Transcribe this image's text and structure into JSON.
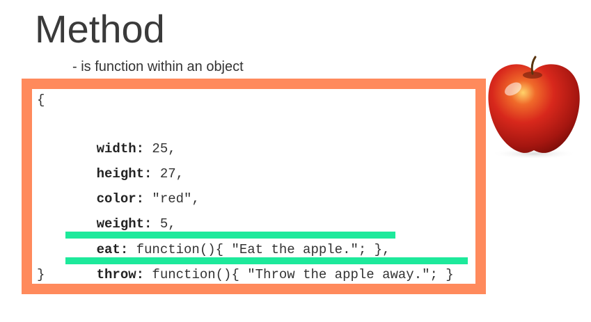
{
  "slide": {
    "title": "Method",
    "subtitle": "- is function within an object"
  },
  "code": {
    "open_brace": "{",
    "close_brace": "}",
    "lines": [
      {
        "key": "width:",
        "rest": " 25,"
      },
      {
        "key": "height:",
        "rest": " 27,"
      },
      {
        "key": "color:",
        "rest": " \"red\","
      },
      {
        "key": "weight:",
        "rest": " 5,"
      },
      {
        "key": "eat:",
        "rest": " function(){ \"Eat the apple.\"; },"
      },
      {
        "key": "throw:",
        "rest": " function(){ \"Throw the apple away.\"; }"
      }
    ]
  },
  "colors": {
    "frame": "#ff8a5c",
    "highlight": "#1de99b",
    "apple": "#d42a1e"
  },
  "image": {
    "apple": "apple-photo"
  }
}
